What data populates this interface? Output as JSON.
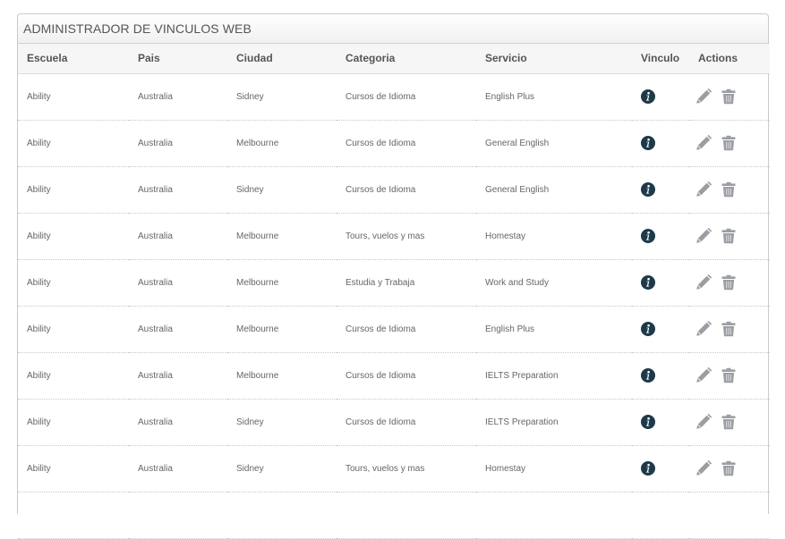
{
  "panel": {
    "title": "ADMINISTRADOR DE VINCULOS WEB"
  },
  "table": {
    "columns": [
      "Escuela",
      "Pais",
      "Ciudad",
      "Categoria",
      "Servicio",
      "Vinculo",
      "Actions"
    ],
    "rows": [
      [
        "Ability",
        "Australia",
        "Sidney",
        "Cursos de Idioma",
        "English Plus"
      ],
      [
        "Ability",
        "Australia",
        "Melbourne",
        "Cursos de Idioma",
        "General English"
      ],
      [
        "Ability",
        "Australia",
        "Sidney",
        "Cursos de Idioma",
        "General English"
      ],
      [
        "Ability",
        "Australia",
        "Melbourne",
        "Tours, vuelos y mas",
        "Homestay"
      ],
      [
        "Ability",
        "Australia",
        "Melbourne",
        "Estudia y Trabaja",
        "Work and Study"
      ],
      [
        "Ability",
        "Australia",
        "Melbourne",
        "Cursos de Idioma",
        "English Plus"
      ],
      [
        "Ability",
        "Australia",
        "Melbourne",
        "Cursos de Idioma",
        "IELTS Preparation"
      ],
      [
        "Ability",
        "Australia",
        "Sidney",
        "Cursos de Idioma",
        "IELTS Preparation"
      ],
      [
        "Ability",
        "Australia",
        "Sidney",
        "Tours, vuelos y mas",
        "Homestay"
      ],
      [
        "",
        "",
        "",
        "",
        ""
      ]
    ]
  },
  "icons": {
    "vinculo": "info-icon",
    "edit": "pencil-icon",
    "delete": "trash-icon"
  },
  "colors": {
    "info_icon": "#1d3a4a",
    "action_icon": "#9a9ea4"
  }
}
